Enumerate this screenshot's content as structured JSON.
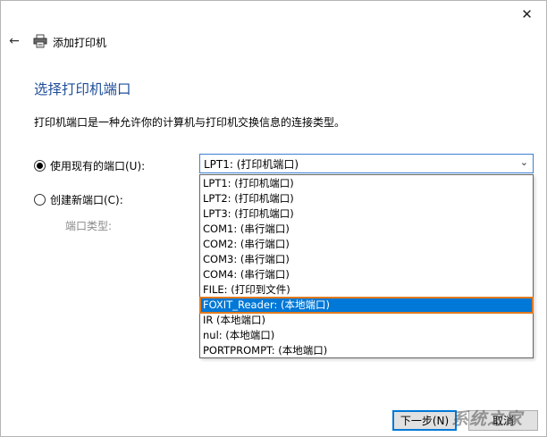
{
  "window": {
    "title": "添加打印机",
    "close_glyph": "✕",
    "back_glyph": "←",
    "icons": {
      "back": "back-arrow-icon",
      "printer": "printer-icon",
      "close": "close-icon",
      "dropdown": "chevron-down-icon"
    }
  },
  "page": {
    "heading": "选择打印机端口",
    "description": "打印机端口是一种允许你的计算机与打印机交换信息的连接类型。"
  },
  "options": {
    "use_existing_label": "使用现有的端口(U):",
    "use_existing_checked": true,
    "create_new_label": "创建新端口(C):",
    "create_new_checked": false,
    "port_type_label": "端口类型:"
  },
  "port_select": {
    "selected_value": "LPT1: (打印机端口)",
    "chevron": "⌄",
    "items": [
      "LPT1: (打印机端口)",
      "LPT2: (打印机端口)",
      "LPT3: (打印机端口)",
      "COM1: (串行端口)",
      "COM2: (串行端口)",
      "COM3: (串行端口)",
      "COM4: (串行端口)",
      "FILE: (打印到文件)",
      "FOXIT_Reader: (本地端口)",
      "IR (本地端口)",
      "nul: (本地端口)",
      "PORTPROMPT: (本地端口)"
    ],
    "highlighted_index": 8,
    "highlight_color": "#0078d7",
    "annotation_color": "#e07a1f"
  },
  "footer": {
    "next_label": "下一步(N)",
    "cancel_label": "取消"
  },
  "watermark": {
    "text": "系统之家"
  }
}
